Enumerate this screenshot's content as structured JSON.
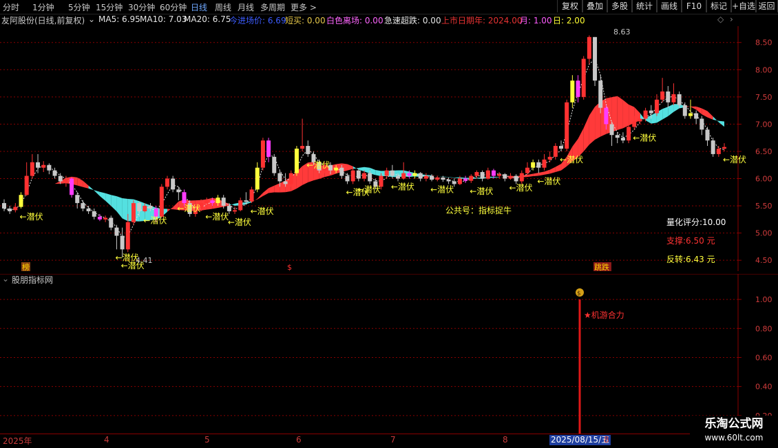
{
  "toolbar": {
    "periods": [
      "分时",
      "1分钟",
      "5分钟",
      "15分钟",
      "30分钟",
      "60分钟",
      "日线",
      "周线",
      "月线",
      "多周期",
      "更多 >"
    ],
    "active_period": "日线",
    "tools": [
      "复权",
      "叠加",
      "多股",
      "统计",
      "画线",
      "F10",
      "标记",
      "+自选",
      "返回"
    ]
  },
  "info": {
    "stock_title": "友阿股份(日线,前复权)",
    "ma5": "MA5: 6.95",
    "ma10": "MA10: 7.03",
    "ma20": "MA20: 6.75",
    "indicators": [
      {
        "text": "今进场价: 6.69",
        "color": "#3c5cff"
      },
      {
        "text": "短买: 0.00",
        "color": "#e6c84a"
      },
      {
        "text": "白色离场: 0.00",
        "color": "#ff66ff"
      },
      {
        "text": "急速超跌: 0.00",
        "color": "#e6e6e6"
      },
      {
        "text": "上市日期年: 2024.00",
        "color": "#e63232"
      },
      {
        "text": "月: 1.00",
        "color": "#ff5cff"
      },
      {
        "text": "日: 2.00",
        "color": "#ffff33"
      }
    ]
  },
  "main_chart": {
    "y_ticks": [
      "8.50",
      "8.00",
      "7.50",
      "7.00",
      "6.50",
      "6.00",
      "5.50",
      "5.00",
      "4.50"
    ],
    "high_label": "8.63",
    "low_label": "4.41",
    "signal_label": "←潜伏",
    "public_account": "公共号：指标捉牛",
    "score_label": "量化评分:10.00",
    "support_label": "支撑:6.50 元",
    "reversal_label": "反转:6.43 元",
    "tag_left": "榜",
    "tag_mid": "$",
    "tag_right": "跳跌"
  },
  "chart_data": {
    "type": "candlestick",
    "y_range": [
      4.3,
      8.8
    ],
    "candles": [
      [
        5.55,
        5.45,
        5.62,
        5.4
      ],
      [
        5.45,
        5.4,
        5.5,
        5.35
      ],
      [
        5.42,
        5.48,
        5.55,
        5.38
      ],
      [
        5.48,
        5.7,
        5.75,
        5.45
      ],
      [
        5.7,
        6.05,
        6.3,
        5.68
      ],
      [
        6.05,
        6.3,
        6.45,
        6.0
      ],
      [
        6.3,
        6.2,
        6.45,
        6.1
      ],
      [
        6.2,
        6.25,
        6.32,
        6.12
      ],
      [
        6.25,
        6.15,
        6.28,
        6.08
      ],
      [
        6.15,
        6.05,
        6.2,
        6.0
      ],
      [
        6.05,
        5.95,
        6.1,
        5.9
      ],
      [
        5.95,
        6.0,
        6.05,
        5.85
      ],
      [
        6.0,
        5.7,
        6.02,
        5.65
      ],
      [
        5.7,
        5.55,
        5.75,
        5.45
      ],
      [
        5.55,
        5.45,
        5.6,
        5.4
      ],
      [
        5.45,
        5.4,
        5.5,
        5.35
      ],
      [
        5.4,
        5.3,
        5.45,
        5.25
      ],
      [
        5.3,
        5.25,
        5.35,
        5.22
      ],
      [
        5.25,
        5.28,
        5.32,
        5.2
      ],
      [
        5.28,
        5.1,
        5.32,
        5.05
      ],
      [
        5.1,
        4.95,
        5.15,
        4.7
      ],
      [
        4.95,
        4.7,
        5.1,
        4.55
      ],
      [
        4.7,
        5.2,
        5.35,
        4.65
      ],
      [
        5.2,
        5.55,
        5.6,
        5.15
      ],
      [
        5.55,
        5.4,
        5.58,
        5.3
      ],
      [
        5.4,
        5.5,
        5.55,
        5.38
      ],
      [
        5.5,
        5.45,
        5.55,
        5.4
      ],
      [
        5.45,
        5.3,
        5.5,
        5.2
      ],
      [
        5.3,
        5.85,
        5.9,
        5.28
      ],
      [
        5.85,
        6.0,
        6.05,
        5.8
      ],
      [
        6.0,
        5.8,
        6.05,
        5.75
      ],
      [
        5.8,
        5.75,
        5.85,
        5.6
      ],
      [
        5.75,
        5.55,
        5.8,
        5.5
      ],
      [
        5.55,
        5.35,
        5.6,
        5.3
      ],
      [
        5.35,
        5.45,
        5.5,
        5.3
      ],
      [
        5.45,
        5.55,
        5.62,
        5.4
      ],
      [
        5.55,
        5.6,
        5.65,
        5.45
      ],
      [
        5.6,
        5.55,
        5.65,
        5.5
      ],
      [
        5.55,
        5.65,
        5.7,
        5.5
      ],
      [
        5.65,
        5.5,
        5.7,
        5.45
      ],
      [
        5.5,
        5.4,
        5.55,
        5.35
      ],
      [
        5.4,
        5.42,
        5.48,
        5.35
      ],
      [
        5.42,
        5.6,
        5.65,
        5.4
      ],
      [
        5.6,
        5.58,
        5.75,
        5.52
      ],
      [
        5.58,
        5.8,
        5.85,
        5.55
      ],
      [
        5.8,
        6.2,
        6.3,
        5.75
      ],
      [
        6.2,
        6.7,
        6.75,
        6.15
      ],
      [
        6.7,
        6.4,
        6.75,
        6.3
      ],
      [
        6.4,
        6.1,
        6.45,
        6.05
      ],
      [
        6.1,
        5.95,
        6.15,
        5.85
      ],
      [
        5.95,
        5.9,
        6.1,
        5.85
      ],
      [
        5.9,
        6.1,
        6.15,
        5.85
      ],
      [
        6.1,
        6.55,
        6.6,
        6.05
      ],
      [
        6.55,
        6.6,
        7.1,
        6.5
      ],
      [
        6.6,
        6.45,
        6.7,
        6.4
      ],
      [
        6.45,
        6.3,
        6.5,
        6.25
      ],
      [
        6.3,
        6.15,
        6.35,
        6.1
      ],
      [
        6.15,
        6.25,
        6.3,
        6.1
      ],
      [
        6.25,
        6.15,
        6.3,
        6.08
      ],
      [
        6.15,
        6.2,
        6.25,
        6.1
      ],
      [
        6.2,
        6.05,
        6.25,
        6.0
      ],
      [
        6.05,
        5.95,
        6.1,
        5.9
      ],
      [
        5.95,
        6.15,
        6.2,
        5.9
      ],
      [
        6.15,
        6.0,
        6.18,
        5.95
      ],
      [
        6.0,
        6.1,
        6.15,
        5.95
      ],
      [
        6.1,
        5.95,
        6.15,
        5.9
      ],
      [
        5.95,
        5.85,
        6.0,
        5.8
      ],
      [
        5.85,
        6.05,
        6.1,
        5.8
      ],
      [
        6.05,
        6.15,
        6.2,
        6.0
      ],
      [
        6.15,
        6.05,
        6.25,
        6.0
      ],
      [
        6.05,
        6.0,
        6.1,
        5.95
      ],
      [
        6.0,
        6.1,
        6.3,
        5.98
      ],
      [
        6.1,
        6.05,
        6.15,
        6.0
      ],
      [
        6.05,
        6.1,
        6.15,
        6.0
      ],
      [
        6.1,
        6.0,
        6.12,
        5.95
      ],
      [
        6.0,
        6.05,
        6.1,
        5.95
      ],
      [
        6.05,
        5.98,
        6.08,
        5.95
      ],
      [
        5.98,
        6.02,
        6.05,
        5.95
      ],
      [
        6.02,
        5.98,
        6.05,
        5.94
      ],
      [
        5.98,
        5.95,
        6.02,
        5.9
      ],
      [
        5.95,
        5.9,
        6.0,
        5.85
      ],
      [
        5.9,
        6.0,
        6.05,
        5.88
      ],
      [
        6.0,
        5.96,
        6.05,
        5.92
      ],
      [
        5.96,
        6.05,
        6.08,
        5.92
      ],
      [
        6.05,
        6.12,
        6.15,
        6.0
      ],
      [
        6.12,
        6.0,
        6.15,
        5.95
      ],
      [
        6.0,
        6.15,
        6.2,
        5.98
      ],
      [
        6.15,
        6.05,
        6.18,
        6.0
      ],
      [
        6.05,
        6.08,
        6.12,
        6.0
      ],
      [
        6.08,
        6.0,
        6.1,
        5.95
      ],
      [
        6.0,
        6.05,
        6.1,
        5.98
      ],
      [
        6.05,
        5.95,
        6.08,
        5.9
      ],
      [
        5.95,
        6.1,
        6.15,
        5.9
      ],
      [
        6.1,
        6.2,
        6.3,
        6.05
      ],
      [
        6.2,
        6.3,
        6.35,
        6.15
      ],
      [
        6.3,
        6.2,
        6.35,
        6.1
      ],
      [
        6.2,
        6.35,
        6.45,
        6.15
      ],
      [
        6.35,
        6.4,
        6.5,
        6.3
      ],
      [
        6.4,
        6.6,
        6.65,
        6.35
      ],
      [
        6.6,
        6.55,
        6.7,
        6.5
      ],
      [
        6.55,
        7.4,
        7.45,
        6.5
      ],
      [
        7.4,
        7.8,
        7.9,
        7.3
      ],
      [
        7.8,
        7.5,
        7.9,
        7.4
      ],
      [
        7.5,
        8.2,
        8.25,
        7.45
      ],
      [
        8.2,
        8.6,
        8.63,
        8.1
      ],
      [
        8.6,
        7.8,
        8.6,
        7.7
      ],
      [
        7.8,
        7.3,
        7.9,
        7.2
      ],
      [
        7.3,
        7.0,
        7.35,
        6.9
      ],
      [
        7.0,
        6.8,
        7.05,
        6.6
      ],
      [
        6.8,
        6.75,
        6.85,
        6.65
      ],
      [
        6.75,
        6.7,
        6.85,
        6.65
      ],
      [
        6.7,
        6.95,
        7.0,
        6.65
      ],
      [
        6.95,
        7.05,
        7.15,
        6.9
      ],
      [
        7.05,
        7.1,
        7.2,
        7.0
      ],
      [
        7.1,
        7.25,
        7.3,
        7.05
      ],
      [
        7.25,
        7.2,
        7.35,
        7.1
      ],
      [
        7.2,
        7.45,
        7.55,
        7.15
      ],
      [
        7.45,
        7.6,
        7.85,
        7.4
      ],
      [
        7.6,
        7.4,
        7.7,
        7.3
      ],
      [
        7.4,
        7.55,
        7.75,
        7.35
      ],
      [
        7.55,
        7.35,
        7.6,
        7.3
      ],
      [
        7.35,
        7.15,
        7.4,
        7.1
      ],
      [
        7.15,
        7.2,
        7.45,
        7.1
      ],
      [
        7.2,
        7.1,
        7.25,
        7.0
      ],
      [
        7.1,
        6.9,
        7.15,
        6.8
      ],
      [
        6.9,
        6.7,
        6.95,
        6.6
      ],
      [
        6.7,
        6.45,
        6.75,
        6.4
      ],
      [
        6.45,
        6.55,
        6.6,
        6.4
      ],
      [
        6.55,
        6.58,
        6.65,
        6.5
      ]
    ]
  },
  "sub_chart": {
    "title": "股朋指标网",
    "y_ticks": [
      "1.00",
      "0.80",
      "0.60",
      "0.40",
      "0.20"
    ],
    "signal_value": 1.0,
    "signal_label": "★机游合力",
    "signal_icon": "money-bag-icon"
  },
  "date_axis": {
    "labels": [
      "2025年",
      "4",
      "5",
      "6",
      "7",
      "8",
      "8"
    ],
    "selected_date": "2025/08/15/五"
  },
  "watermark": {
    "line1": "乐淘公式网",
    "line2": "www.60lt.com"
  },
  "colors": {
    "up": "#ff3232",
    "down": "#54ffff",
    "grid": "#8b0000",
    "ribbon_red": "#ff3a3a",
    "ribbon_cyan": "#54e0e0",
    "gray": "#c8c8c8",
    "magenta": "#ff3cff",
    "yellow": "#ffff3c"
  }
}
